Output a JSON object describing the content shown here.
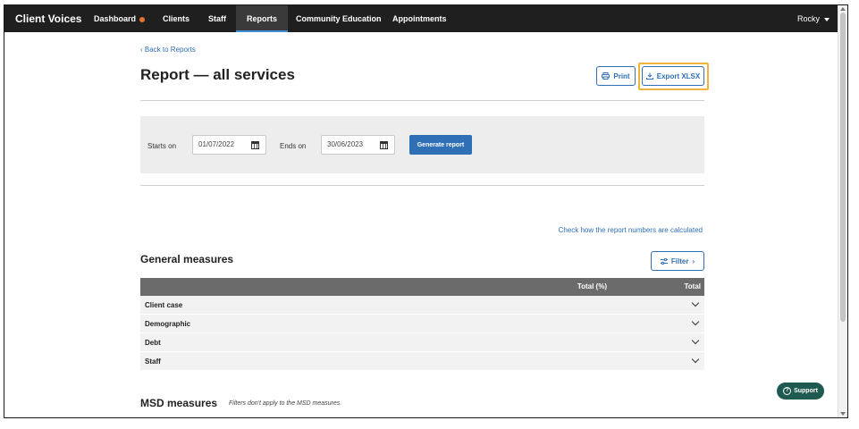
{
  "nav": {
    "brand": "Client Voices",
    "items": [
      {
        "label": "Dashboard"
      },
      {
        "label": "Clients"
      },
      {
        "label": "Staff"
      },
      {
        "label": "Reports"
      },
      {
        "label": "Community Education"
      },
      {
        "label": "Appointments"
      }
    ],
    "active": "Reports",
    "user": "Rocky",
    "notification_color": "#e8742c"
  },
  "page": {
    "back_link": "Back to Reports",
    "title": "Report — all services",
    "print_label": "Print",
    "export_label": "Export XLSX"
  },
  "filters": {
    "starts_label": "Starts on",
    "starts_value": "01/07/2022",
    "ends_label": "Ends on",
    "ends_value": "30/06/2023",
    "generate_label": "Generate report"
  },
  "calc_link": "Check how the report numbers are calculated",
  "general": {
    "title": "General measures",
    "filter_label": "Filter",
    "columns": [
      "Total (%)",
      "Total"
    ],
    "rows": [
      {
        "label": "Client case"
      },
      {
        "label": "Demographic"
      },
      {
        "label": "Debt"
      },
      {
        "label": "Staff"
      }
    ]
  },
  "msd": {
    "title": "MSD measures",
    "note": "Filters don't apply to the MSD measures."
  },
  "support_label": "Support",
  "colors": {
    "accent": "#2f6fb6",
    "nav_bg": "#1f1f1f",
    "highlight": "#f0b43c",
    "support_bg": "#1e5a4f"
  }
}
